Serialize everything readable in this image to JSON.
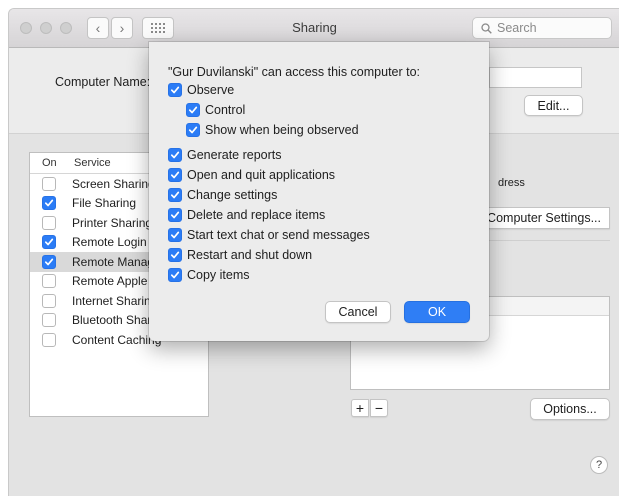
{
  "window": {
    "title": "Sharing"
  },
  "search": {
    "placeholder": "Search"
  },
  "computer_name": {
    "label": "Computer Name:",
    "edit_button": "Edit..."
  },
  "services": {
    "header_on": "On",
    "header_service": "Service",
    "items": [
      {
        "label": "Screen Sharing",
        "checked": false
      },
      {
        "label": "File Sharing",
        "checked": true
      },
      {
        "label": "Printer Sharing",
        "checked": false
      },
      {
        "label": "Remote Login",
        "checked": true
      },
      {
        "label": "Remote Management",
        "checked": true,
        "selected": true
      },
      {
        "label": "Remote Apple Events",
        "checked": false
      },
      {
        "label": "Internet Sharing",
        "checked": false
      },
      {
        "label": "Bluetooth Sharing",
        "checked": false
      },
      {
        "label": "Content Caching",
        "checked": false
      }
    ]
  },
  "right_panel": {
    "address_text": "dress",
    "computer_settings_button": "Computer Settings...",
    "plus_label": "+",
    "minus_label": "−",
    "options_button": "Options..."
  },
  "sheet": {
    "heading": "\"Gur Duvilanski\" can access this computer to:",
    "options": [
      {
        "label": "Observe",
        "checked": true
      },
      {
        "label": "Control",
        "checked": true,
        "indent": true
      },
      {
        "label": "Show when being observed",
        "checked": true,
        "indent": true
      },
      {
        "label": "Generate reports",
        "checked": true
      },
      {
        "label": "Open and quit applications",
        "checked": true
      },
      {
        "label": "Change settings",
        "checked": true
      },
      {
        "label": "Delete and replace items",
        "checked": true
      },
      {
        "label": "Start text chat or send messages",
        "checked": true
      },
      {
        "label": "Restart and shut down",
        "checked": true
      },
      {
        "label": "Copy items",
        "checked": true
      }
    ],
    "cancel_button": "Cancel",
    "ok_button": "OK"
  },
  "help_label": "?",
  "colors": {
    "accent": "#2b7cf6",
    "ok_button": "#2f7ef5"
  }
}
